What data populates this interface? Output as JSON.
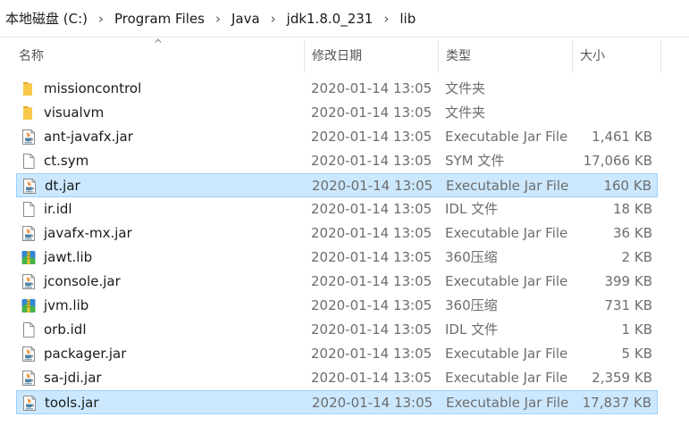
{
  "breadcrumb": {
    "items": [
      "本地磁盘 (C:)",
      "Program Files",
      "Java",
      "jdk1.8.0_231",
      "lib"
    ],
    "separator": "›"
  },
  "columns": {
    "name": "名称",
    "date": "修改日期",
    "type": "类型",
    "size": "大小",
    "sort_arrow": "^"
  },
  "colors": {
    "selection_bg": "#cce8ff",
    "selection_border": "#99d1ff",
    "folder": "#f8c94a",
    "secondary_text": "#6d6d6d"
  },
  "files": [
    {
      "name": "missioncontrol",
      "date": "2020-01-14 13:05",
      "type": "文件夹",
      "size": "",
      "icon": "folder-icon",
      "selected": false
    },
    {
      "name": "visualvm",
      "date": "2020-01-14 13:05",
      "type": "文件夹",
      "size": "",
      "icon": "folder-icon",
      "selected": false
    },
    {
      "name": "ant-javafx.jar",
      "date": "2020-01-14 13:05",
      "type": "Executable Jar File",
      "size": "1,461 KB",
      "icon": "java-jar-icon",
      "selected": false
    },
    {
      "name": "ct.sym",
      "date": "2020-01-14 13:05",
      "type": "SYM 文件",
      "size": "17,066 KB",
      "icon": "blank-file-icon",
      "selected": false
    },
    {
      "name": "dt.jar",
      "date": "2020-01-14 13:05",
      "type": "Executable Jar File",
      "size": "160 KB",
      "icon": "java-jar-icon",
      "selected": true
    },
    {
      "name": "ir.idl",
      "date": "2020-01-14 13:05",
      "type": "IDL 文件",
      "size": "18 KB",
      "icon": "blank-file-icon",
      "selected": false
    },
    {
      "name": "javafx-mx.jar",
      "date": "2020-01-14 13:05",
      "type": "Executable Jar File",
      "size": "36 KB",
      "icon": "java-jar-icon",
      "selected": false
    },
    {
      "name": "jawt.lib",
      "date": "2020-01-14 13:05",
      "type": "360压缩",
      "size": "2 KB",
      "icon": "archive-icon",
      "selected": false
    },
    {
      "name": "jconsole.jar",
      "date": "2020-01-14 13:05",
      "type": "Executable Jar File",
      "size": "399 KB",
      "icon": "java-jar-icon",
      "selected": false
    },
    {
      "name": "jvm.lib",
      "date": "2020-01-14 13:05",
      "type": "360压缩",
      "size": "731 KB",
      "icon": "archive-icon",
      "selected": false
    },
    {
      "name": "orb.idl",
      "date": "2020-01-14 13:05",
      "type": "IDL 文件",
      "size": "1 KB",
      "icon": "blank-file-icon",
      "selected": false
    },
    {
      "name": "packager.jar",
      "date": "2020-01-14 13:05",
      "type": "Executable Jar File",
      "size": "5 KB",
      "icon": "java-jar-icon",
      "selected": false
    },
    {
      "name": "sa-jdi.jar",
      "date": "2020-01-14 13:05",
      "type": "Executable Jar File",
      "size": "2,359 KB",
      "icon": "java-jar-icon",
      "selected": false
    },
    {
      "name": "tools.jar",
      "date": "2020-01-14 13:05",
      "type": "Executable Jar File",
      "size": "17,837 KB",
      "icon": "java-jar-icon",
      "selected": true
    }
  ]
}
